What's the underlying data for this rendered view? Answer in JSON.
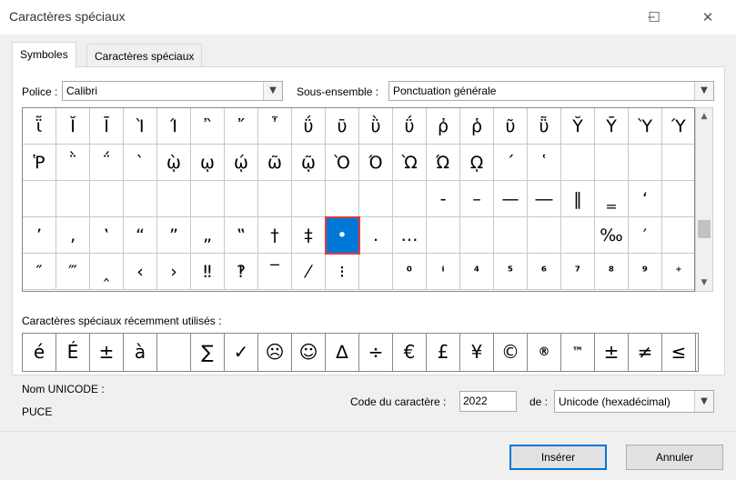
{
  "window": {
    "title": "Caractères spéciaux",
    "minimize": "─",
    "maximize": "☐",
    "close": "✕"
  },
  "tabs": [
    {
      "label": "Symboles"
    },
    {
      "label": "Caractères spéciaux"
    }
  ],
  "font": {
    "label": "Police :",
    "value": "Calibri"
  },
  "subset": {
    "label": "Sous-ensemble :",
    "value": "Ponctuation générale"
  },
  "grid": {
    "rows": [
      [
        "ῗ",
        "Ῐ",
        "Ῑ",
        "Ὶ",
        "Ί",
        "῍",
        "῎",
        "῏",
        "ΰ",
        "ῡ",
        "ῢ",
        "ΰ",
        "ῤ",
        "ῥ",
        "ῦ",
        "ῧ",
        "Ῠ",
        "Ῡ",
        "Ὺ",
        "Ύ"
      ],
      [
        "Ῥ",
        "῭",
        "΅",
        "`",
        "ῲ",
        "ῳ",
        "ῴ",
        "ῶ",
        "ῷ",
        "Ὸ",
        "Ό",
        "Ὼ",
        "Ώ",
        "ῼ",
        "´",
        "῾",
        "",
        "",
        "",
        ""
      ],
      [
        "",
        "",
        "",
        "",
        "",
        "",
        "",
        "",
        "",
        "",
        "",
        "",
        "-",
        "–",
        "—",
        "―",
        "‖",
        "‗",
        "‘",
        ""
      ],
      [
        "’",
        "‚",
        "‛",
        "“",
        "”",
        "„",
        "‟",
        "†",
        "‡",
        "•",
        "․",
        "…",
        "",
        "",
        "",
        "",
        "",
        "‰",
        "′",
        ""
      ],
      [
        "″",
        "‴",
        "‸",
        "‹",
        "›",
        "‼",
        "‽",
        "‾",
        "⁄",
        "⁝",
        "",
        "⁰",
        "ⁱ",
        "⁴",
        "⁵",
        "⁶",
        "⁷",
        "⁸",
        "⁹",
        "⁺"
      ]
    ],
    "selected": {
      "row": 3,
      "col": 9
    }
  },
  "recent": {
    "label": "Caractères spéciaux récemment utilisés :",
    "chars": [
      "é",
      "É",
      "±",
      "à",
      " ",
      "∑",
      "✓",
      "☹",
      "☺",
      "∆",
      "÷",
      "€",
      "£",
      "¥",
      "©",
      "®",
      "™",
      "±",
      "≠",
      "≤"
    ]
  },
  "unicode": {
    "label": "Nom UNICODE :",
    "name": "PUCE"
  },
  "code": {
    "label": "Code du caractère :",
    "value": "2022"
  },
  "from": {
    "label": "de :",
    "value": "Unicode (hexadécimal)"
  },
  "buttons": {
    "insert": "Insérer",
    "cancel": "Annuler"
  }
}
